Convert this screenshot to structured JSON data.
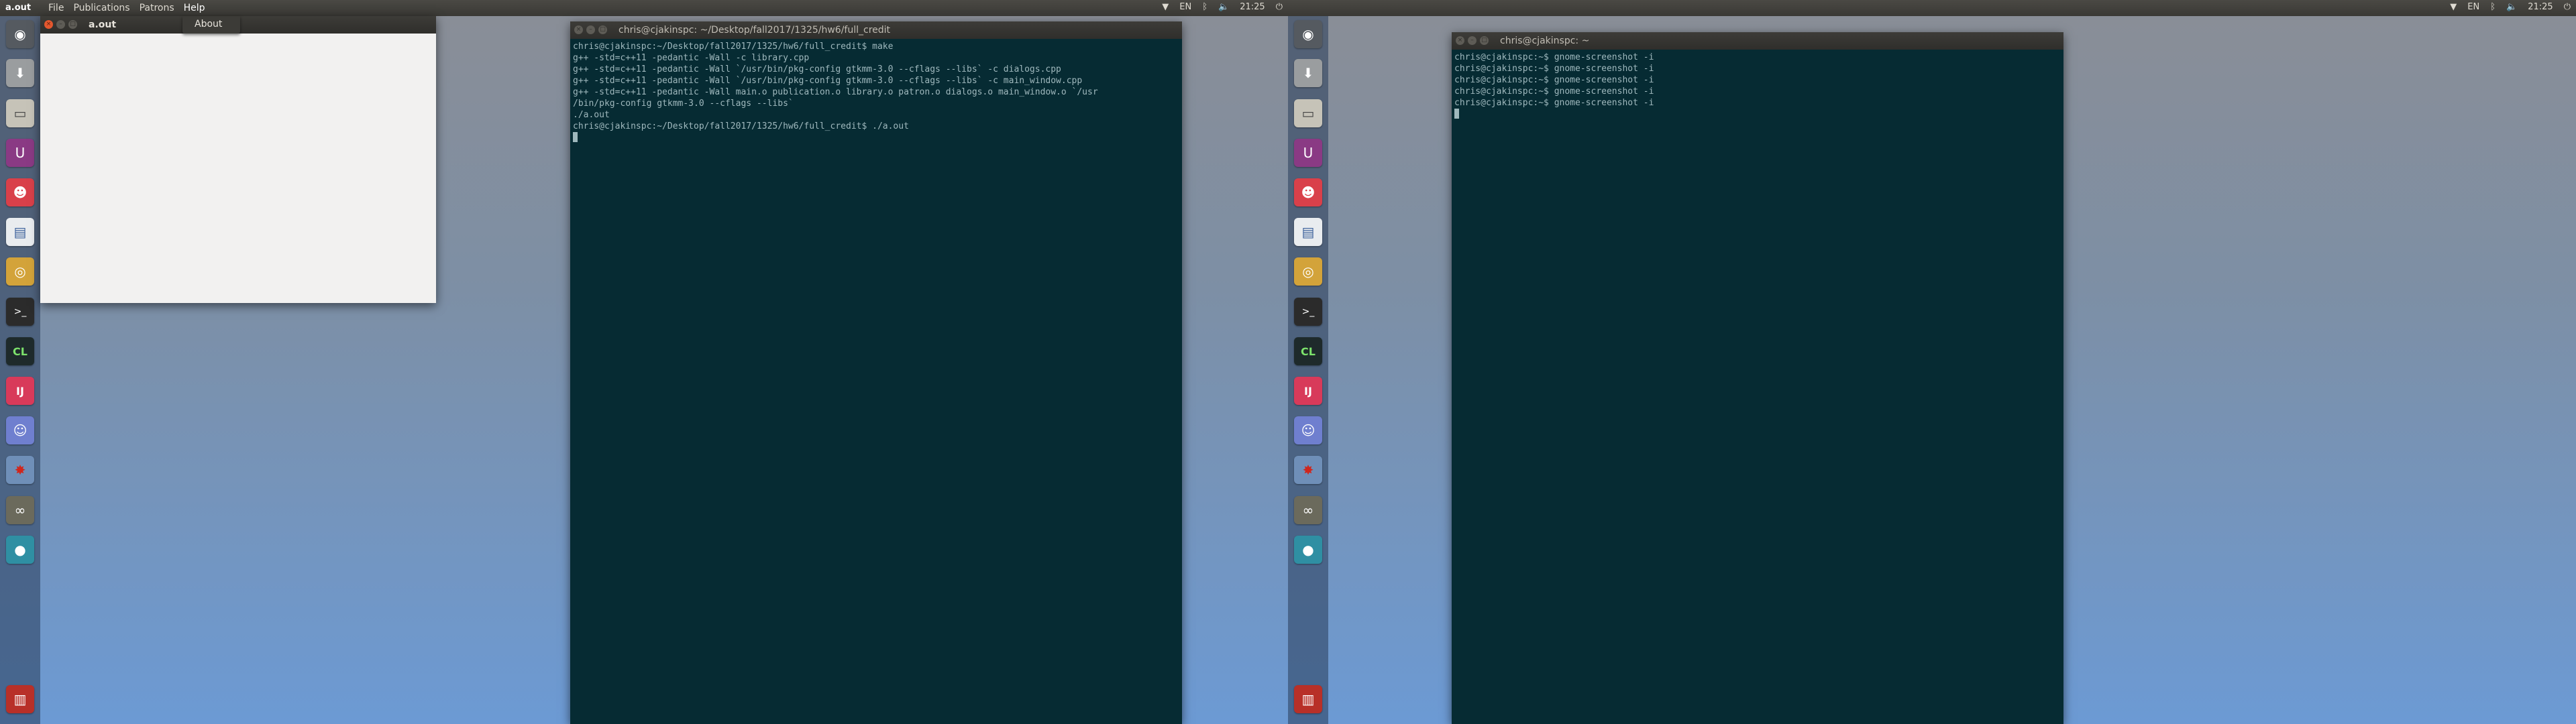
{
  "topbar": {
    "app_name": "a.out",
    "menu": [
      "File",
      "Publications",
      "Patrons",
      "Help"
    ],
    "tray": {
      "keyboard": "EN",
      "time": "21:25"
    }
  },
  "help_menu": {
    "items": [
      "About"
    ]
  },
  "topbar2": {
    "tray": {
      "keyboard": "EN",
      "time": "21:25"
    }
  },
  "launcher_items": [
    "ubuntu-dash-icon",
    "files-download-icon",
    "file-manager-icon",
    "unity-tweak-icon",
    "red-game-icon",
    "text-editor-icon",
    "chrome-icon",
    "terminal-icon",
    "clion-icon",
    "intellij-icon",
    "discord-icon",
    "red-figure-icon",
    "gimp-icon",
    "record-icon",
    "trash-icon"
  ],
  "aout_window": {
    "title": "a.out"
  },
  "terminal1": {
    "title": "chris@cjakinspc: ~/Desktop/fall2017/1325/hw6/full_credit",
    "lines": [
      "chris@cjakinspc:~/Desktop/fall2017/1325/hw6/full_credit$ make",
      "g++ -std=c++11 -pedantic -Wall -c library.cpp",
      "g++ -std=c++11 -pedantic -Wall `/usr/bin/pkg-config gtkmm-3.0 --cflags --libs` -c dialogs.cpp",
      "g++ -std=c++11 -pedantic -Wall `/usr/bin/pkg-config gtkmm-3.0 --cflags --libs` -c main_window.cpp",
      "g++ -std=c++11 -pedantic -Wall main.o publication.o library.o patron.o dialogs.o main_window.o `/usr",
      "/bin/pkg-config gtkmm-3.0 --cflags --libs`",
      "./a.out",
      "chris@cjakinspc:~/Desktop/fall2017/1325/hw6/full_credit$ ./a.out"
    ]
  },
  "terminal2": {
    "title": "chris@cjakinspc: ~",
    "lines": [
      "chris@cjakinspc:~$ gnome-screenshot -i",
      "chris@cjakinspc:~$ gnome-screenshot -i",
      "chris@cjakinspc:~$ gnome-screenshot -i",
      "chris@cjakinspc:~$ gnome-screenshot -i",
      "chris@cjakinspc:~$ gnome-screenshot -i"
    ]
  }
}
